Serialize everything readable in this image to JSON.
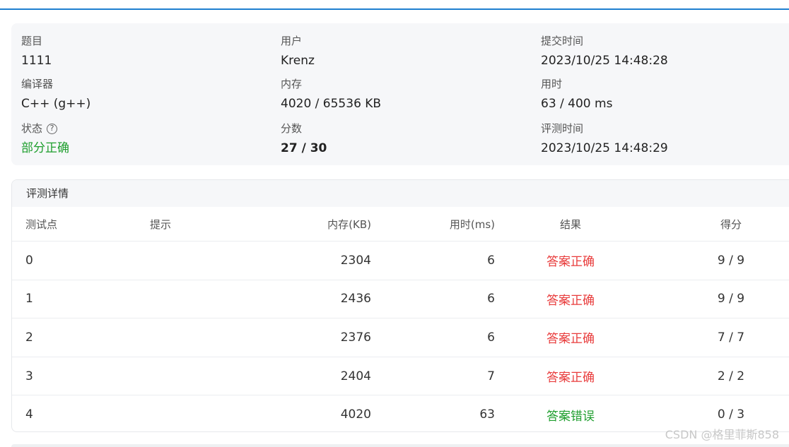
{
  "summary": {
    "problem_label": "题目",
    "problem_value": "1111",
    "user_label": "用户",
    "user_value": "Krenz",
    "submit_time_label": "提交时间",
    "submit_time_value": "2023/10/25 14:48:28",
    "compiler_label": "编译器",
    "compiler_value": "C++ (g++)",
    "memory_label": "内存",
    "memory_value": "4020 / 65536 KB",
    "time_label": "用时",
    "time_value": "63 / 400 ms",
    "status_label": "状态",
    "status_value": "部分正确",
    "score_label": "分数",
    "score_value": "27 / 30",
    "judge_time_label": "评测时间",
    "judge_time_value": "2023/10/25 14:48:29",
    "help_icon": "?"
  },
  "details": {
    "title": "评测详情",
    "columns": {
      "case": "测试点",
      "hint": "提示",
      "memory": "内存(KB)",
      "time": "用时(ms)",
      "result": "结果",
      "score": "得分"
    },
    "rows": [
      {
        "case": "0",
        "hint": "",
        "memory": "2304",
        "time": "6",
        "result": "答案正确",
        "score": "9 / 9"
      },
      {
        "case": "1",
        "hint": "",
        "memory": "2436",
        "time": "6",
        "result": "答案正确",
        "score": "9 / 9"
      },
      {
        "case": "2",
        "hint": "",
        "memory": "2376",
        "time": "6",
        "result": "答案正确",
        "score": "7 / 7"
      },
      {
        "case": "3",
        "hint": "",
        "memory": "2404",
        "time": "7",
        "result": "答案正确",
        "score": "2 / 2"
      },
      {
        "case": "4",
        "hint": "",
        "memory": "4020",
        "time": "63",
        "result": "答案错误",
        "score": "0 / 3"
      }
    ]
  },
  "watermark": "CSDN @格里菲斯858",
  "colors": {
    "accent": "#1f7fd0",
    "correct": "#e83b3b",
    "wrong": "#1e9e2d",
    "partial": "#1e9e2d"
  }
}
